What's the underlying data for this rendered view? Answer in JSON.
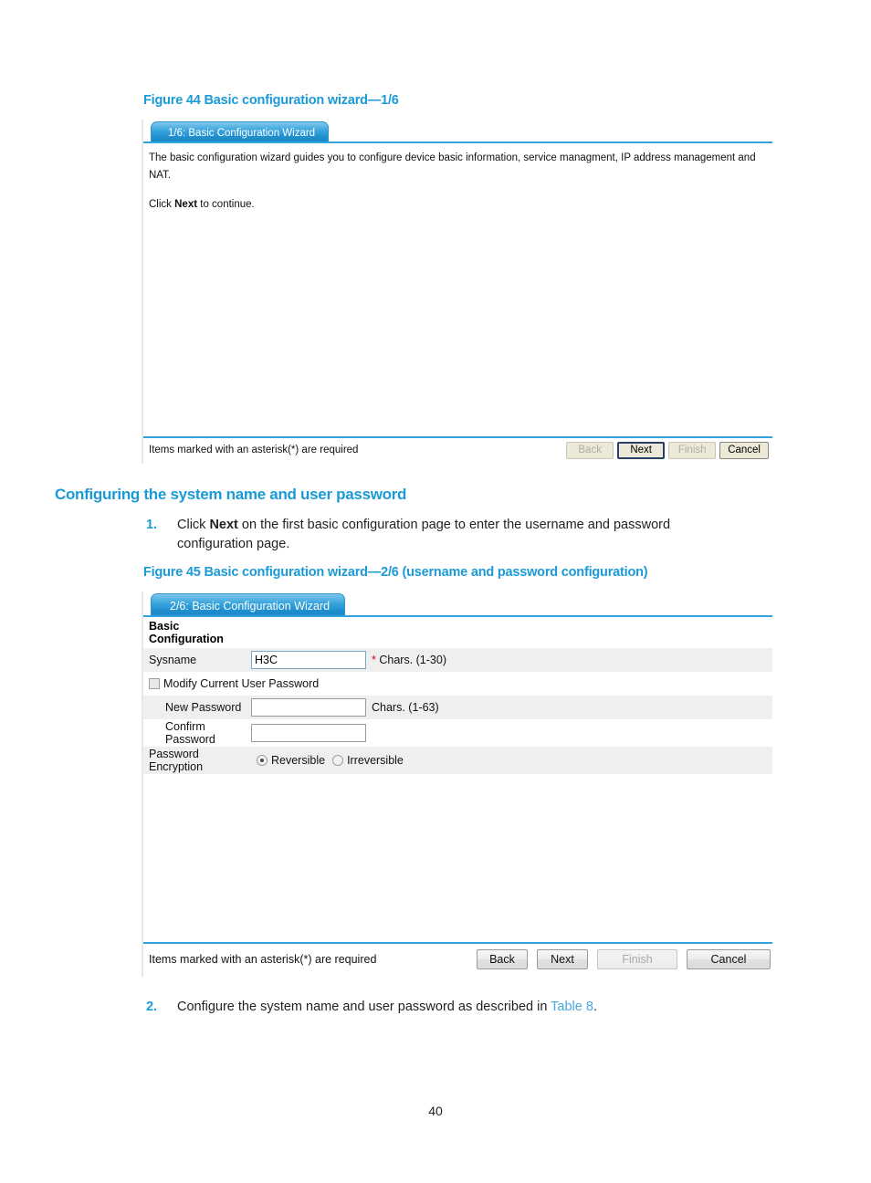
{
  "page": {
    "number": "40"
  },
  "figure44": {
    "caption": "Figure 44 Basic configuration wizard—1/6",
    "tab_label": "1/6: Basic Configuration Wizard",
    "intro_line1": "The basic configuration wizard guides you to configure device basic information, service managment, IP address management and NAT.",
    "intro_line2_pre": "Click ",
    "intro_line2_bold": "Next",
    "intro_line2_post": " to continue.",
    "footer_note": "Items marked with an asterisk(*) are required",
    "buttons": {
      "back": "Back",
      "next": "Next",
      "finish": "Finish",
      "cancel": "Cancel"
    }
  },
  "section": {
    "heading": "Configuring the system name and user password"
  },
  "step1": {
    "number": "1.",
    "text_pre": "Click ",
    "text_bold": "Next",
    "text_post": " on the first basic configuration page to enter the username and password configuration page."
  },
  "figure45": {
    "caption": "Figure 45 Basic configuration wizard—2/6 (username and password configuration)",
    "tab_label": "2/6: Basic Configuration Wizard",
    "section_title_line1": "Basic",
    "section_title_line2": "Configuration",
    "fields": {
      "sysname_label": "Sysname",
      "sysname_value": "H3C",
      "sysname_hint_star": "*",
      "sysname_hint": " Chars. (1-30)",
      "modify_password_label": "Modify Current User Password",
      "new_password_label": "New Password",
      "new_password_value": "",
      "new_password_hint": "Chars. (1-63)",
      "confirm_password_label_line1": "Confirm",
      "confirm_password_label_line2": "Password",
      "confirm_password_value": "",
      "encryption_label_line1": "Password",
      "encryption_label_line2": "Encryption",
      "radio_reversible": "Reversible",
      "radio_irreversible": "Irreversible"
    },
    "footer_note": "Items marked with an asterisk(*) are required",
    "buttons": {
      "back": "Back",
      "next": "Next",
      "finish": "Finish",
      "cancel": "Cancel"
    }
  },
  "step2": {
    "number": "2.",
    "text_pre": "Configure the system name and user password as described in ",
    "link": "Table 8",
    "text_post": "."
  }
}
